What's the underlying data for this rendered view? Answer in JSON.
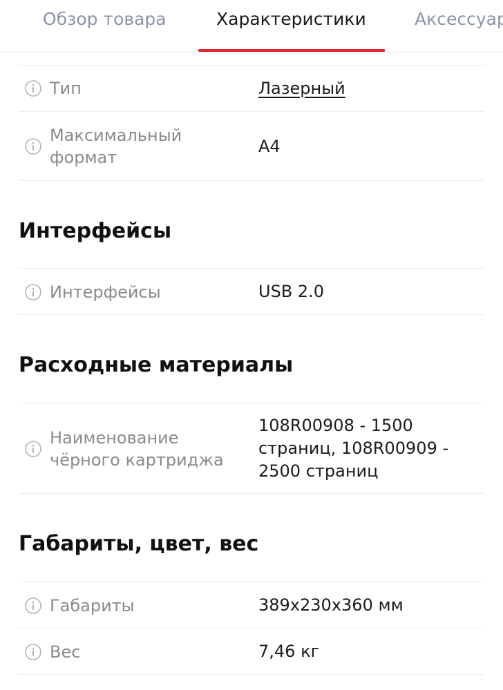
{
  "tabs": [
    {
      "label": "Обзор товара",
      "active": false
    },
    {
      "label": "Характеристики",
      "active": true
    },
    {
      "label": "Аксессуары",
      "active": false
    }
  ],
  "accent_color": "#e3242f",
  "info_icon": "info-circle-icon",
  "rows": {
    "type": {
      "label": "Тип",
      "value": "Лазерный"
    },
    "max_format": {
      "label_line1": "Максимальный",
      "label_line2": "формат",
      "value": "A4"
    },
    "interfaces": {
      "label": "Интерфейсы",
      "value": "USB 2.0"
    },
    "cartridge": {
      "label_line1": "Наименование",
      "label_line2": "чёрного картриджа",
      "value_line1": "108R00908 - 1500",
      "value_line2": "страниц, 108R00909 -",
      "value_line3": "2500 страниц"
    },
    "dimensions": {
      "label": "Габариты",
      "value": "389x230x360 мм"
    },
    "weight": {
      "label": "Вес",
      "value": "7,46 кг"
    }
  },
  "sections": {
    "interfaces": "Интерфейсы",
    "consumables": "Расходные материалы",
    "dimensions": "Габариты, цвет, вес"
  }
}
